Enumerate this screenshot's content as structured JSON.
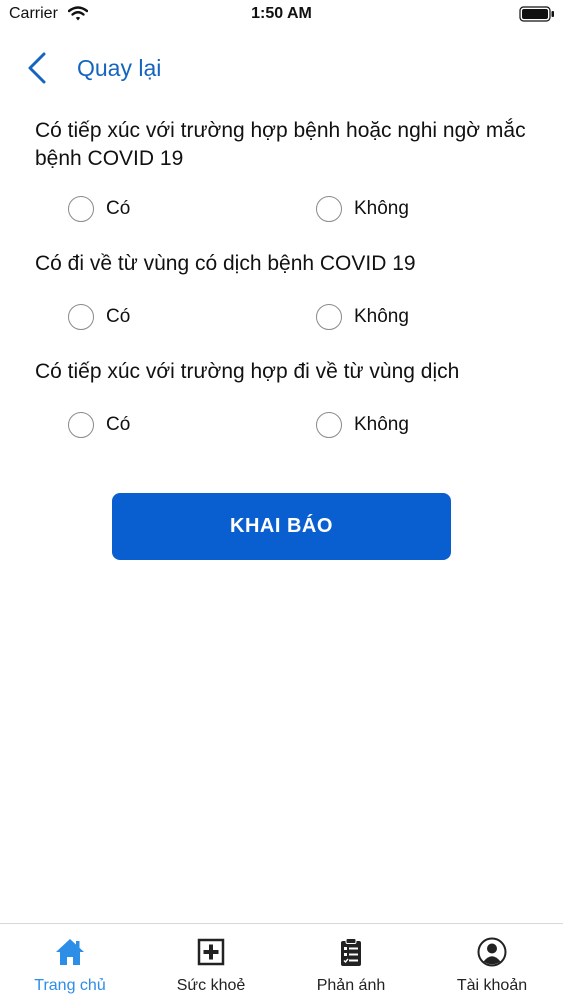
{
  "status_bar": {
    "carrier": "Carrier",
    "time": "1:50 AM"
  },
  "nav": {
    "back_label": "Quay lại"
  },
  "questions": [
    {
      "text": "Có tiếp xúc với trường hợp bệnh hoặc nghi ngờ mắc bệnh COVID 19",
      "options": [
        "Có",
        "Không"
      ],
      "selected": null
    },
    {
      "text": "Có đi về từ vùng có dịch bệnh COVID 19",
      "options": [
        "Có",
        "Không"
      ],
      "selected": null
    },
    {
      "text": "Có tiếp xúc với trường hợp đi về từ vùng dịch",
      "options": [
        "Có",
        "Không"
      ],
      "selected": null
    }
  ],
  "submit_label": "KHAI BÁO",
  "tabs": [
    {
      "label": "Trang chủ",
      "icon": "home-icon",
      "active": true
    },
    {
      "label": "Sức khoẻ",
      "icon": "medical-cross-icon",
      "active": false
    },
    {
      "label": "Phản ánh",
      "icon": "clipboard-icon",
      "active": false
    },
    {
      "label": "Tài khoản",
      "icon": "account-icon",
      "active": false
    }
  ],
  "colors": {
    "accent": "#1565c0",
    "button": "#0a5fd0",
    "tab_active": "#2d8ee8"
  }
}
